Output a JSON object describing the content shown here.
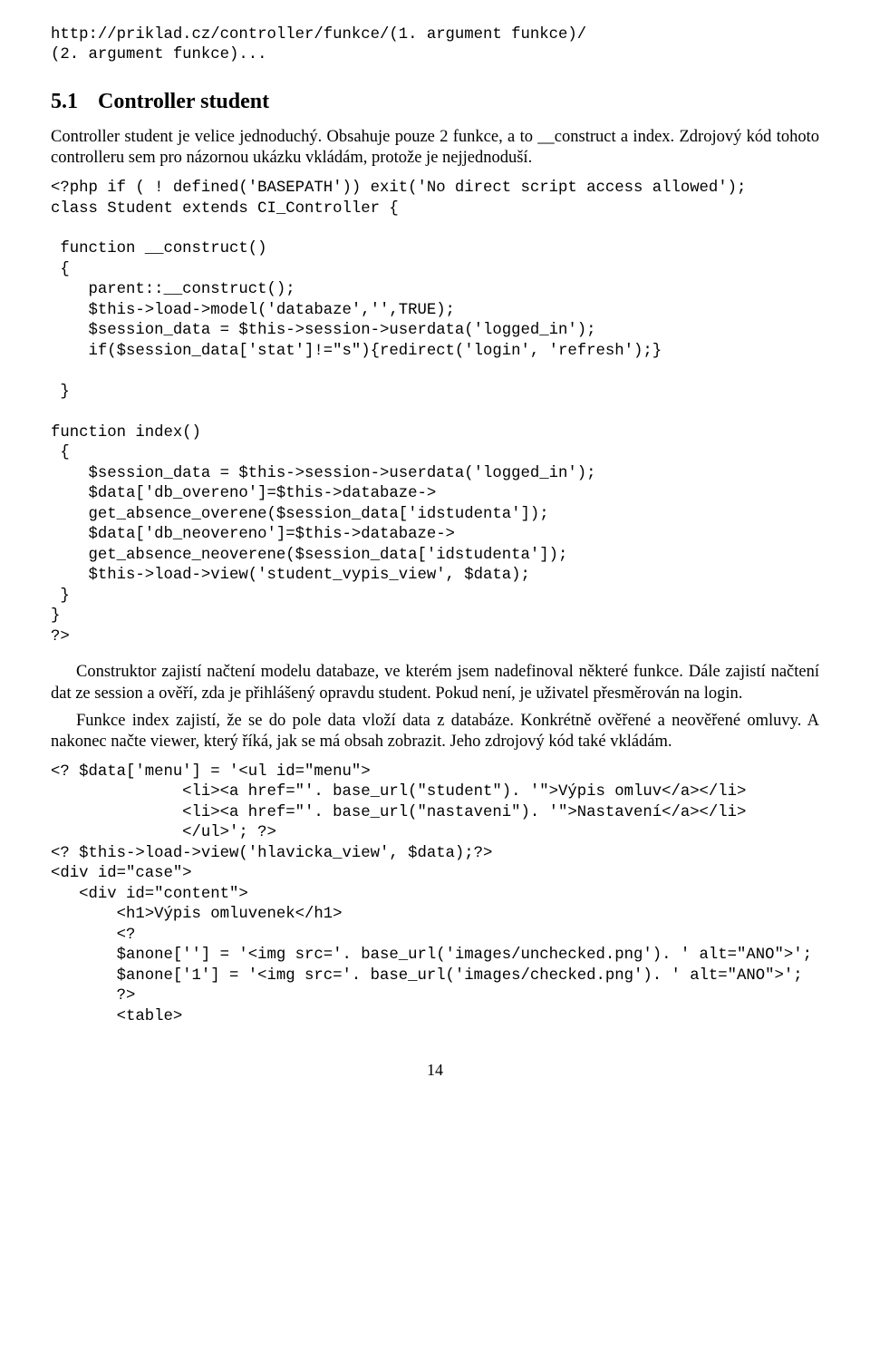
{
  "url_line1": "http://priklad.cz/controller/funkce/(1. argument funkce)/",
  "url_line2": "(2. argument funkce)...",
  "section": {
    "num": "5.1",
    "title": "Controller student"
  },
  "para1": "Controller student je velice jednoduchý. Obsahuje pouze 2 funkce, a to __construct a index. Zdrojový kód tohoto controlleru sem pro názornou ukázku vkládám, protože je nejjednoduší.",
  "code1": "<?php if ( ! defined('BASEPATH')) exit('No direct script access allowed');\nclass Student extends CI_Controller {\n\n function __construct()\n {\n    parent::__construct();\n    $this->load->model('databaze','',TRUE);\n    $session_data = $this->session->userdata('logged_in');\n    if($session_data['stat']!=\"s\"){redirect('login', 'refresh');}\n\n }\n\nfunction index()\n {\n    $session_data = $this->session->userdata('logged_in');\n    $data['db_overeno']=$this->databaze->\n    get_absence_overene($session_data['idstudenta']);\n    $data['db_neovereno']=$this->databaze->\n    get_absence_neoverene($session_data['idstudenta']);\n    $this->load->view('student_vypis_view', $data);\n }\n}\n?>",
  "para2": "Construktor zajistí načtení modelu databaze, ve kterém jsem nadefinoval některé funkce. Dále zajistí načtení dat ze session a ověří, zda je přihlášený opravdu student. Pokud není, je uživatel přesměrován na login.",
  "para3": "Funkce index zajistí, že se do pole data vloží data z databáze. Konkrétně ověřené a neověřené omluvy. A nakonec načte viewer, který říká, jak se má obsah zobrazit. Jeho zdrojový kód také vkládám.",
  "code2": "<? $data['menu'] = '<ul id=\"menu\">\n              <li><a href=\"'. base_url(\"student\"). '\">Výpis omluv</a></li>\n              <li><a href=\"'. base_url(\"nastaveni\"). '\">Nastavení</a></li>\n              </ul>'; ?>\n<? $this->load->view('hlavicka_view', $data);?>\n<div id=\"case\">\n   <div id=\"content\">\n       <h1>Výpis omluvenek</h1>\n       <?\n       $anone[''] = '<img src='. base_url('images/unchecked.png'). ' alt=\"ANO\">';\n       $anone['1'] = '<img src='. base_url('images/checked.png'). ' alt=\"ANO\">';\n       ?>\n       <table>",
  "pagenum": "14"
}
